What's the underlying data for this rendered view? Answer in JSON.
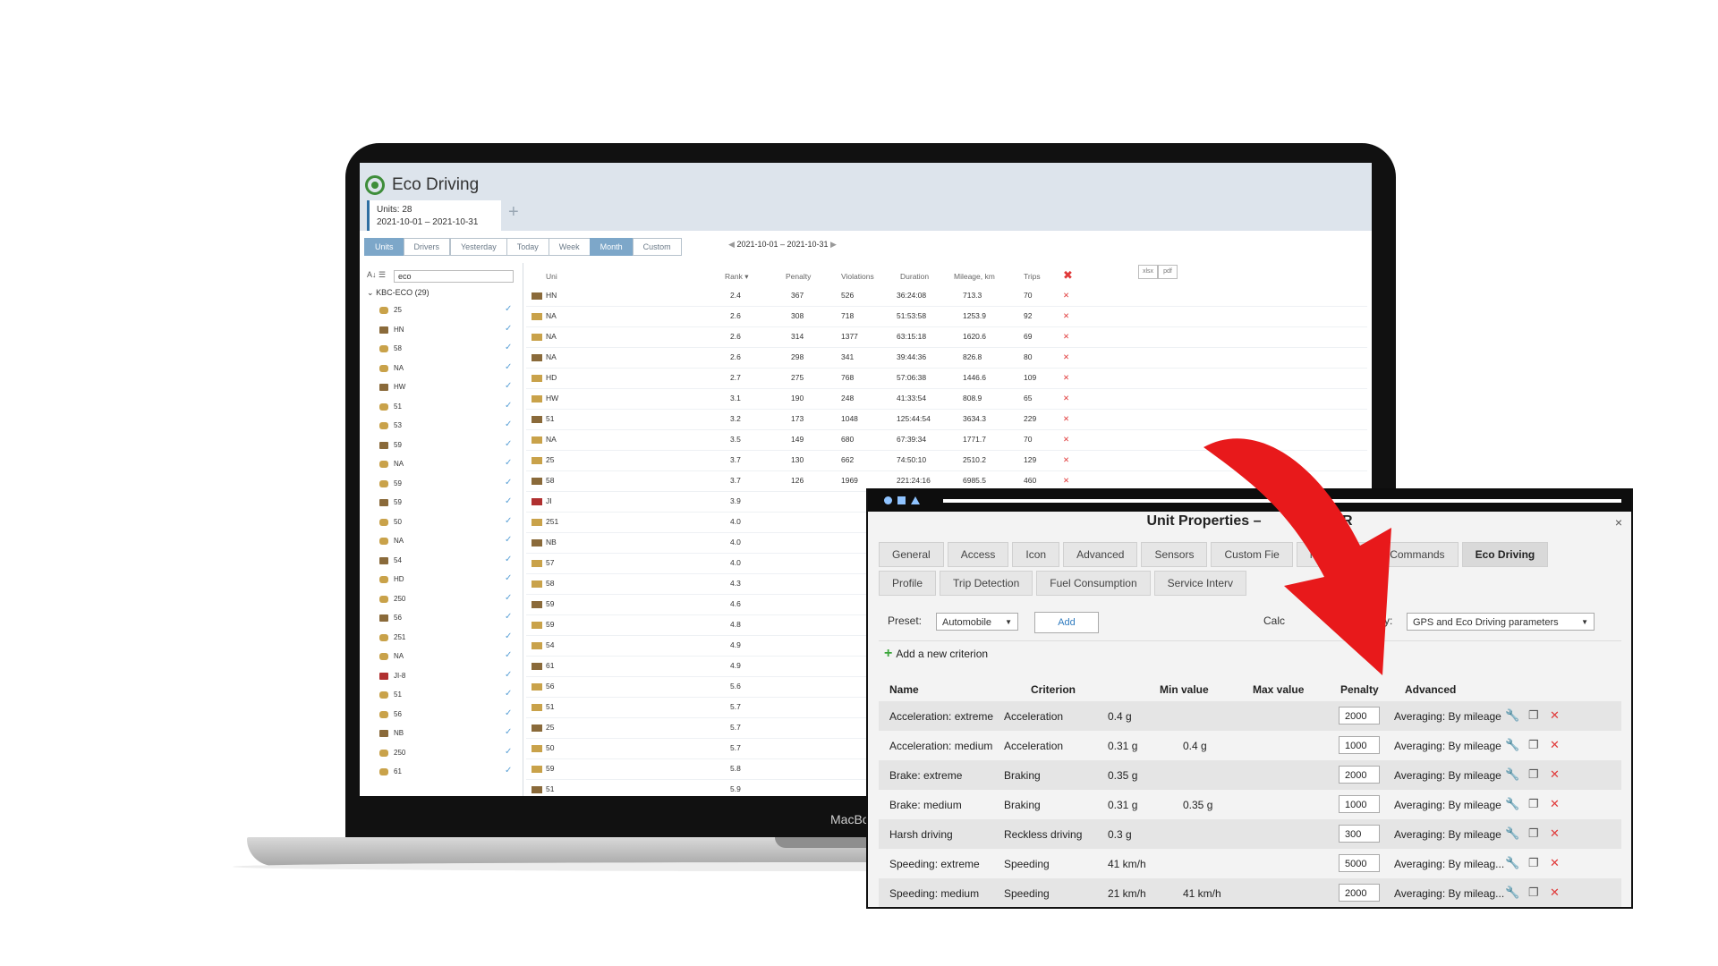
{
  "app": {
    "title": "Eco Driving",
    "units_count": "Units: 28",
    "date_range_card": "2021-10-01 – 2021-10-31",
    "add_tab": "+",
    "mode_buttons": [
      "Units",
      "Drivers"
    ],
    "period_buttons": [
      "Yesterday",
      "Today",
      "Week",
      "Month",
      "Custom"
    ],
    "active_period": "Month",
    "range_label": "2021-10-01 – 2021-10-31",
    "search_value": "eco",
    "sort_icon": "az-sort-icon",
    "group_label": "KBC-ECO (29)",
    "export_xlsx": "xlsx",
    "export_pdf": "pdf",
    "laptop_label": "MacBo"
  },
  "left_list": [
    "25",
    "HN",
    "58",
    "NA",
    "HW",
    "51",
    "53",
    "59",
    "NA",
    "59",
    "59",
    "50",
    "NA",
    "54",
    "HD",
    "250",
    "56",
    "251",
    "NA",
    "JI-8",
    "51",
    "56",
    "NB",
    "250",
    "61"
  ],
  "table": {
    "headers": {
      "unit": "Uni",
      "rank": "Rank",
      "penalty": "Penalty",
      "violations": "Violations",
      "duration": "Duration",
      "mileage": "Mileage, km",
      "trips": "Trips"
    },
    "rows": [
      {
        "unit": "HN",
        "rank": "2.4",
        "penalty": "367",
        "violations": "526",
        "duration": "36:24:08",
        "mileage": "713.3",
        "trips": "70"
      },
      {
        "unit": "NA",
        "rank": "2.6",
        "penalty": "308",
        "violations": "718",
        "duration": "51:53:58",
        "mileage": "1253.9",
        "trips": "92"
      },
      {
        "unit": "NA",
        "rank": "2.6",
        "penalty": "314",
        "violations": "1377",
        "duration": "63:15:18",
        "mileage": "1620.6",
        "trips": "69"
      },
      {
        "unit": "NA",
        "rank": "2.6",
        "penalty": "298",
        "violations": "341",
        "duration": "39:44:36",
        "mileage": "826.8",
        "trips": "80"
      },
      {
        "unit": "HD",
        "rank": "2.7",
        "penalty": "275",
        "violations": "768",
        "duration": "57:06:38",
        "mileage": "1446.6",
        "trips": "109"
      },
      {
        "unit": "HW",
        "rank": "3.1",
        "penalty": "190",
        "violations": "248",
        "duration": "41:33:54",
        "mileage": "808.9",
        "trips": "65"
      },
      {
        "unit": "51",
        "rank": "3.2",
        "penalty": "173",
        "violations": "1048",
        "duration": "125:44:54",
        "mileage": "3634.3",
        "trips": "229"
      },
      {
        "unit": "NA",
        "rank": "3.5",
        "penalty": "149",
        "violations": "680",
        "duration": "67:39:34",
        "mileage": "1771.7",
        "trips": "70"
      },
      {
        "unit": "25",
        "rank": "3.7",
        "penalty": "130",
        "violations": "662",
        "duration": "74:50:10",
        "mileage": "2510.2",
        "trips": "129"
      },
      {
        "unit": "58",
        "rank": "3.7",
        "penalty": "126",
        "violations": "1969",
        "duration": "221:24:16",
        "mileage": "6985.5",
        "trips": "460"
      },
      {
        "unit": "JI",
        "rank": "3.9",
        "penalty": "",
        "violations": "",
        "duration": "",
        "mileage": "",
        "trips": ""
      },
      {
        "unit": "251",
        "rank": "4.0",
        "penalty": "",
        "violations": "",
        "duration": "",
        "mileage": "",
        "trips": ""
      },
      {
        "unit": "NB",
        "rank": "4.0",
        "penalty": "",
        "violations": "",
        "duration": "",
        "mileage": "",
        "trips": ""
      },
      {
        "unit": "57",
        "rank": "4.0",
        "penalty": "",
        "violations": "",
        "duration": "",
        "mileage": "",
        "trips": ""
      },
      {
        "unit": "58",
        "rank": "4.3",
        "penalty": "",
        "violations": "",
        "duration": "",
        "mileage": "",
        "trips": ""
      },
      {
        "unit": "59",
        "rank": "4.6",
        "penalty": "",
        "violations": "",
        "duration": "",
        "mileage": "",
        "trips": ""
      },
      {
        "unit": "59",
        "rank": "4.8",
        "penalty": "",
        "violations": "",
        "duration": "",
        "mileage": "",
        "trips": ""
      },
      {
        "unit": "54",
        "rank": "4.9",
        "penalty": "",
        "violations": "",
        "duration": "",
        "mileage": "",
        "trips": ""
      },
      {
        "unit": "61",
        "rank": "4.9",
        "penalty": "",
        "violations": "",
        "duration": "",
        "mileage": "",
        "trips": ""
      },
      {
        "unit": "56",
        "rank": "5.6",
        "penalty": "",
        "violations": "",
        "duration": "",
        "mileage": "",
        "trips": ""
      },
      {
        "unit": "51",
        "rank": "5.7",
        "penalty": "",
        "violations": "",
        "duration": "",
        "mileage": "",
        "trips": ""
      },
      {
        "unit": "25",
        "rank": "5.7",
        "penalty": "",
        "violations": "",
        "duration": "",
        "mileage": "",
        "trips": ""
      },
      {
        "unit": "50",
        "rank": "5.7",
        "penalty": "",
        "violations": "",
        "duration": "",
        "mileage": "",
        "trips": ""
      },
      {
        "unit": "59",
        "rank": "5.8",
        "penalty": "",
        "violations": "",
        "duration": "",
        "mileage": "",
        "trips": ""
      },
      {
        "unit": "51",
        "rank": "5.9",
        "penalty": "",
        "violations": "",
        "duration": "",
        "mileage": "",
        "trips": ""
      }
    ]
  },
  "dialog": {
    "title": "Unit Properties – ",
    "title_tail": "R",
    "close": "×",
    "tabs_row1": [
      "General",
      "Access",
      "Icon",
      "Advanced",
      "Sensors",
      "Custom Fie",
      "nit Groups",
      "Commands",
      "Eco Driving"
    ],
    "tabs_row2": [
      "Profile",
      "Trip Detection",
      "Fuel Consumption",
      "Service Interv"
    ],
    "active_tab": "Eco Driving",
    "preset_label": "Preset:",
    "preset_value": "Automobile",
    "add_button": "Add",
    "calc_label_left": "Calc",
    "calc_label_right": "y:",
    "calc_value": "GPS and Eco Driving parameters",
    "add_criterion": "Add a new criterion",
    "headers": {
      "name": "Name",
      "criterion": "Criterion",
      "min": "Min value",
      "max": "Max value",
      "penalty": "Penalty",
      "advanced": "Advanced"
    },
    "rows": [
      {
        "name": "Acceleration: extreme",
        "criterion": "Acceleration",
        "min": "0.4 g",
        "max": "",
        "penalty": "2000",
        "advanced": "Averaging: By mileage"
      },
      {
        "name": "Acceleration: medium",
        "criterion": "Acceleration",
        "min": "0.31 g",
        "max": "0.4 g",
        "penalty": "1000",
        "advanced": "Averaging: By mileage"
      },
      {
        "name": "Brake: extreme",
        "criterion": "Braking",
        "min": "0.35 g",
        "max": "",
        "penalty": "2000",
        "advanced": "Averaging: By mileage"
      },
      {
        "name": "Brake: medium",
        "criterion": "Braking",
        "min": "0.31 g",
        "max": "0.35 g",
        "penalty": "1000",
        "advanced": "Averaging: By mileage"
      },
      {
        "name": "Harsh driving",
        "criterion": "Reckless driving",
        "min": "0.3 g",
        "max": "",
        "penalty": "300",
        "advanced": "Averaging: By mileage"
      },
      {
        "name": "Speeding: extreme",
        "criterion": "Speeding",
        "min": "41 km/h",
        "max": "",
        "penalty": "5000",
        "advanced": "Averaging: By mileag..."
      },
      {
        "name": "Speeding: medium",
        "criterion": "Speeding",
        "min": "21 km/h",
        "max": "41 km/h",
        "penalty": "2000",
        "advanced": "Averaging: By mileag..."
      }
    ]
  },
  "colors": {
    "accent": "#7da7c9",
    "delete": "#e03a3a",
    "arrow": "#e8191b",
    "check": "#5aa0d6"
  }
}
